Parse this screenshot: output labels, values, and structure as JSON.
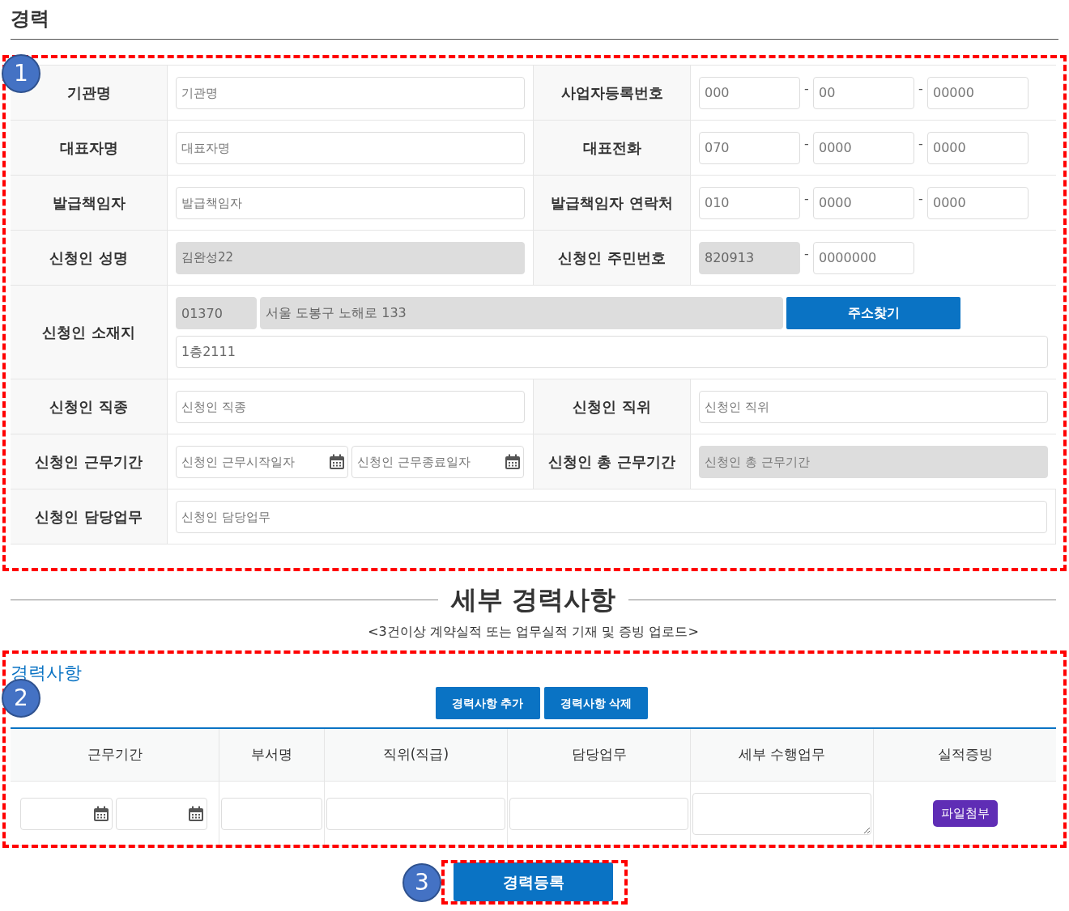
{
  "section_title": "경력",
  "annotations": [
    {
      "number": "1"
    },
    {
      "number": "2"
    },
    {
      "number": "3"
    }
  ],
  "form": {
    "rows": [
      {
        "kind": "pair",
        "cells": [
          {
            "label": "기관명",
            "fields": [
              {
                "kind": "text",
                "placeholder": "기관명",
                "disabled": false
              }
            ]
          },
          {
            "label": "사업자등록번호",
            "fields": [
              {
                "kind": "part",
                "placeholder": "000",
                "disabled": false
              },
              {
                "kind": "part",
                "separator": "-",
                "placeholder": "00",
                "disabled": false
              },
              {
                "kind": "part",
                "separator": "-",
                "placeholder": "00000",
                "disabled": false
              }
            ]
          }
        ]
      },
      {
        "kind": "pair",
        "cells": [
          {
            "label": "대표자명",
            "fields": [
              {
                "kind": "text",
                "placeholder": "대표자명",
                "disabled": false
              }
            ]
          },
          {
            "label": "대표전화",
            "fields": [
              {
                "kind": "part",
                "placeholder": "070",
                "disabled": false
              },
              {
                "kind": "part",
                "separator": "-",
                "placeholder": "0000",
                "disabled": false
              },
              {
                "kind": "part",
                "separator": "-",
                "placeholder": "0000",
                "disabled": false
              }
            ]
          }
        ]
      },
      {
        "kind": "pair",
        "cells": [
          {
            "label": "발급책임자",
            "fields": [
              {
                "kind": "text",
                "placeholder": "발급책임자",
                "disabled": false
              }
            ]
          },
          {
            "label": "발급책임자 연락처",
            "fields": [
              {
                "kind": "part",
                "placeholder": "010",
                "disabled": false
              },
              {
                "kind": "part",
                "separator": "-",
                "placeholder": "0000",
                "disabled": false
              },
              {
                "kind": "part",
                "separator": "-",
                "placeholder": "0000",
                "disabled": false
              }
            ]
          }
        ]
      },
      {
        "kind": "pair",
        "cells": [
          {
            "label": "신청인 성명",
            "fields": [
              {
                "kind": "text",
                "value": "김완성22",
                "disabled": true
              }
            ]
          },
          {
            "label": "신청인 주민번호",
            "fields": [
              {
                "kind": "part",
                "value": "820913",
                "disabled": true
              },
              {
                "kind": "part",
                "separator": "-",
                "placeholder": "0000000",
                "disabled": false
              }
            ]
          }
        ]
      },
      {
        "kind": "address",
        "label": "신청인 소재지",
        "zip": {
          "value": "01370",
          "disabled": true
        },
        "address": {
          "value": "서울 도봉구 노해로 133",
          "disabled": true
        },
        "button": "주소찾기",
        "detail": {
          "value": "1층2111",
          "disabled": false
        }
      },
      {
        "kind": "pair",
        "cells": [
          {
            "label": "신청인 직종",
            "fields": [
              {
                "kind": "text",
                "placeholder": "신청인 직종",
                "disabled": false
              }
            ]
          },
          {
            "label": "신청인 직위",
            "fields": [
              {
                "kind": "text",
                "placeholder": "신청인 직위",
                "disabled": false
              }
            ]
          }
        ]
      },
      {
        "kind": "pair",
        "cells": [
          {
            "label": "신청인 근무기간",
            "fields": [
              {
                "kind": "date",
                "placeholder": "신청인 근무시작일자",
                "disabled": false
              },
              {
                "kind": "date",
                "placeholder": "신청인 근무종료일자",
                "disabled": false
              }
            ]
          },
          {
            "label": "신청인 총 근무기간",
            "fields": [
              {
                "kind": "text",
                "placeholder": "신청인 총 근무기간",
                "disabled": true
              }
            ]
          }
        ]
      },
      {
        "kind": "single",
        "cells": [
          {
            "label": "신청인 담당업무",
            "fields": [
              {
                "kind": "text",
                "placeholder": "신청인 담당업무",
                "disabled": false
              }
            ]
          }
        ]
      }
    ]
  },
  "details": {
    "title": "세부 경력사항",
    "subtitle": "<3건이상 계약실적 또는 업무실적 기재 및 증빙 업로드>",
    "box_title": "경력사항",
    "buttons": [
      "경력사항 추가",
      "경력사항 삭제"
    ],
    "columns": [
      "근무기간",
      "부서명",
      "직위(직급)",
      "담당업무",
      "세부 수행업무",
      "실적증빙"
    ],
    "row": [
      {
        "kind": "dates"
      },
      {
        "kind": "input"
      },
      {
        "kind": "input"
      },
      {
        "kind": "input"
      },
      {
        "kind": "textarea"
      },
      {
        "kind": "file",
        "label": "파일첨부"
      }
    ]
  },
  "submit": "경력등록"
}
